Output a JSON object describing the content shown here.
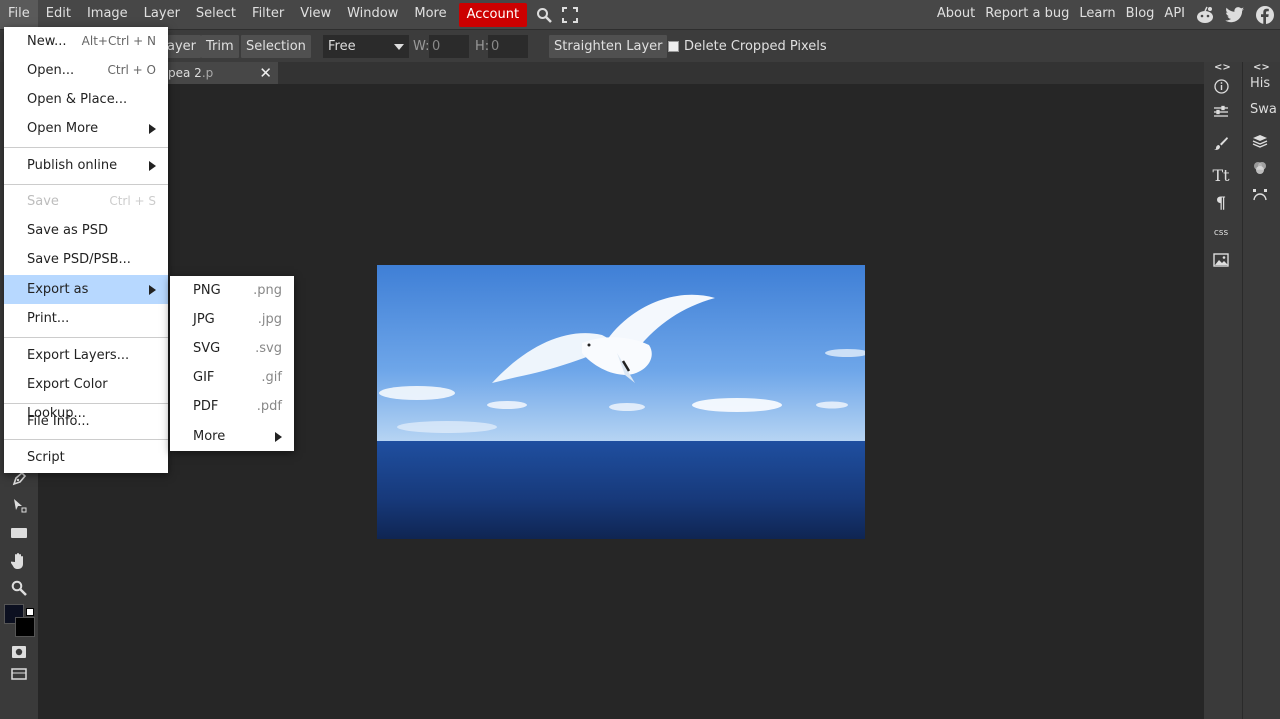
{
  "menubar": {
    "items": [
      "File",
      "Edit",
      "Image",
      "Layer",
      "Select",
      "Filter",
      "View",
      "Window",
      "More"
    ],
    "account": "Account",
    "right_links": [
      "About",
      "Report a bug",
      "Learn",
      "Blog",
      "API"
    ],
    "icons": [
      "search-icon",
      "fullscreen-icon",
      "reddit-icon",
      "twitter-icon",
      "facebook-icon"
    ],
    "account_color": "#cc0000"
  },
  "optbar": {
    "layer_btn": "ayer",
    "trim_btn": "Trim",
    "selection_btn": "Selection",
    "ratio_select": "Free",
    "w_label": "W:",
    "w_value": "0",
    "h_label": "H:",
    "h_value": "0",
    "straighten_btn": "Straighten Layer",
    "delete_cropped_label": "Delete Cropped Pixels"
  },
  "doc_tab": {
    "name": "pea 2",
    "ext": ".p",
    "close": "✕"
  },
  "right_panels": {
    "arrows": "<>",
    "history_label": "His",
    "swatches_label": "Swa",
    "css_label": "css"
  },
  "file_menu": {
    "items": [
      {
        "label": "New...",
        "shortcut": "Alt+Ctrl + N"
      },
      {
        "label": "Open...",
        "shortcut": "Ctrl + O"
      },
      {
        "label": "Open & Place..."
      },
      {
        "label": "Open More"
      },
      {
        "label": "Publish online"
      },
      {
        "label": "Save",
        "shortcut": "Ctrl + S"
      },
      {
        "label": "Save as PSD"
      },
      {
        "label": "Save PSD/PSB..."
      },
      {
        "label": "Export as"
      },
      {
        "label": "Print..."
      },
      {
        "label": "Export Layers..."
      },
      {
        "label": "Export Color Lookup..."
      },
      {
        "label": "File Info..."
      },
      {
        "label": "Script"
      }
    ],
    "highlight_color": "#b7d8ff"
  },
  "export_menu": {
    "items": [
      {
        "label": "PNG",
        "ext": ".png"
      },
      {
        "label": "JPG",
        "ext": ".jpg"
      },
      {
        "label": "SVG",
        "ext": ".svg"
      },
      {
        "label": "GIF",
        "ext": ".gif"
      },
      {
        "label": "PDF",
        "ext": ".pdf"
      },
      {
        "label": "More"
      }
    ]
  }
}
